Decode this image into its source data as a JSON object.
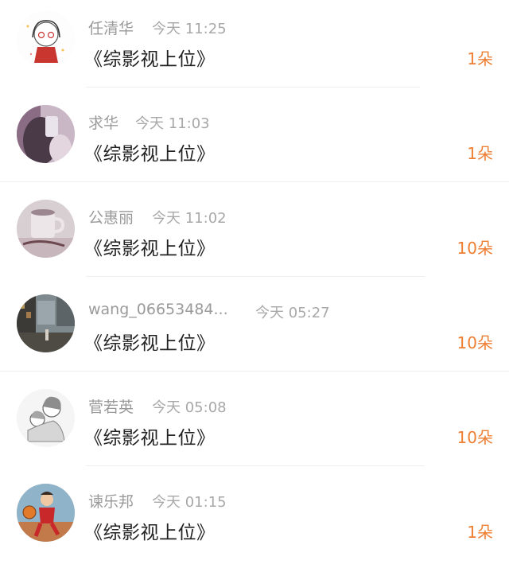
{
  "gifts": [
    {
      "user": "任清华",
      "time": "今天 11:25",
      "item": "《综影视上位》",
      "amount": "1朵",
      "avatar": "sketch-girl-avatar"
    },
    {
      "user": "求华",
      "time": "今天 11:03",
      "item": "《综影视上位》",
      "amount": "1朵",
      "avatar": "mirror-selfie-avatar"
    },
    {
      "user": "公惠丽",
      "time": "今天 11:02",
      "item": "《综影视上位》",
      "amount": "10朵",
      "avatar": "coffee-mug-avatar"
    },
    {
      "user": "wang_06653484...",
      "time": "今天 05:27",
      "item": "《综影视上位》",
      "amount": "10朵",
      "avatar": "city-photo-avatar"
    },
    {
      "user": "菅若英",
      "time": "今天 05:08",
      "item": "《综影视上位》",
      "amount": "10朵",
      "avatar": "sketch-couple-avatar"
    },
    {
      "user": "谏乐邦",
      "time": "今天 01:15",
      "item": "《综影视上位》",
      "amount": "1朵",
      "avatar": "basketball-player-avatar"
    }
  ],
  "colors": {
    "amount": "#ee7e32",
    "name": "#9a9a9a",
    "title": "#222222"
  }
}
